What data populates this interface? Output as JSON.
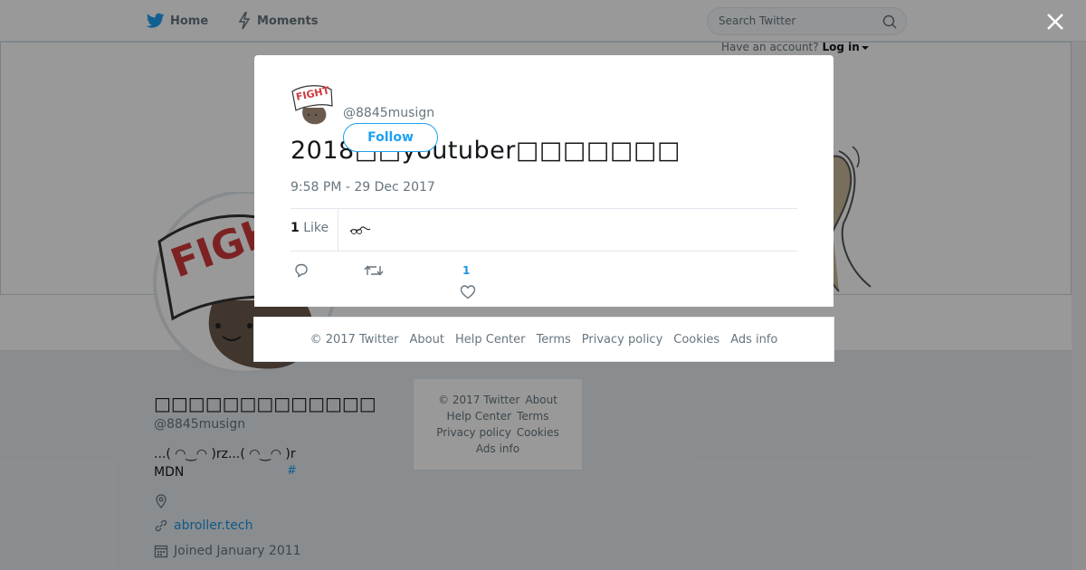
{
  "nav": {
    "home_label": "Home",
    "moments_label": "Moments",
    "search_placeholder": "Search Twitter",
    "have_account": "Have an account?",
    "login_label": "Log in"
  },
  "profile": {
    "name": "□□□□□□□□□□□□□",
    "handle": "@8845musign",
    "bio_line1": "...( ◠‿◠ )rz...( ◠‿◠ )r",
    "bio_line2": "MDN",
    "bio_hashtag": "#",
    "website": "abroller.tech",
    "joined": "Joined January 2011"
  },
  "sidebar_footer": {
    "copyright": "© 2017 Twitter",
    "about": "About",
    "help": "Help Center",
    "terms": "Terms",
    "privacy": "Privacy policy",
    "cookies": "Cookies",
    "ads": "Ads info"
  },
  "tweet": {
    "handle": "@8845musign",
    "follow_label": "Follow",
    "text": "2018□□youtuber□□□□□□□",
    "timestamp": "9:58 PM - 29 Dec 2017",
    "likes_count": "1",
    "likes_label": "Like",
    "like_action_count": "1"
  },
  "footer": {
    "copyright": "© 2017 Twitter",
    "about": "About",
    "help": "Help Center",
    "terms": "Terms",
    "privacy": "Privacy policy",
    "cookies": "Cookies",
    "ads": "Ads info"
  },
  "colors": {
    "brand": "#1da1f2",
    "link": "#1b95e0",
    "overlay": "rgba(0,0,0,0.4)"
  },
  "icons": [
    "twitter-bird-icon",
    "lightning-icon",
    "search-icon",
    "close-icon",
    "location-icon",
    "link-icon",
    "calendar-icon",
    "reply-icon",
    "retweet-icon",
    "heart-icon"
  ]
}
